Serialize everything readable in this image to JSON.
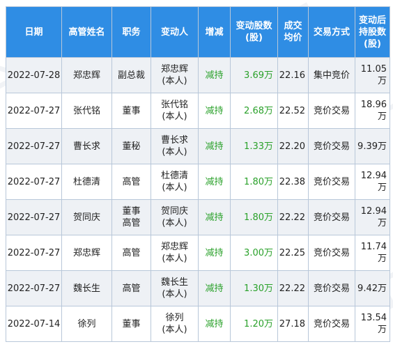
{
  "headers": {
    "date": "日期",
    "name": "高管姓名",
    "position": [
      "职务"
    ],
    "changer": "变动人",
    "direction": "增减",
    "change_shares": [
      "变动股数",
      "(股)"
    ],
    "avg_price": [
      "成交",
      "均价"
    ],
    "method": "交易方式",
    "holdings": [
      "变动后",
      "持股数",
      "(股)"
    ]
  },
  "rows": [
    {
      "date": "2022-07-28",
      "name": "郑忠辉",
      "position": [
        "副总裁"
      ],
      "changer": [
        "郑忠辉",
        "(本人)"
      ],
      "direction": "减持",
      "shares": "3.69万",
      "price": "22.16",
      "method": "集中竞价",
      "holdings": "11.05万"
    },
    {
      "date": "2022-07-27",
      "name": "张代铭",
      "position": [
        "董事"
      ],
      "changer": [
        "张代铭",
        "(本人)"
      ],
      "direction": "减持",
      "shares": "2.68万",
      "price": "22.52",
      "method": "竞价交易",
      "holdings": "18.96万"
    },
    {
      "date": "2022-07-27",
      "name": "曹长求",
      "position": [
        "董秘"
      ],
      "changer": [
        "曹长求",
        "(本人)"
      ],
      "direction": "减持",
      "shares": "1.33万",
      "price": "22.20",
      "method": "竞价交易",
      "holdings": "9.39万"
    },
    {
      "date": "2022-07-27",
      "name": "杜德清",
      "position": [
        "高管"
      ],
      "changer": [
        "杜德清",
        "(本人)"
      ],
      "direction": "减持",
      "shares": "1.80万",
      "price": "22.38",
      "method": "竞价交易",
      "holdings": "12.94万"
    },
    {
      "date": "2022-07-27",
      "name": "贺同庆",
      "position": [
        "董事",
        "高管"
      ],
      "changer": [
        "贺同庆",
        "(本人)"
      ],
      "direction": "减持",
      "shares": "1.80万",
      "price": "22.22",
      "method": "竞价交易",
      "holdings": "12.94万"
    },
    {
      "date": "2022-07-27",
      "name": "郑忠辉",
      "position": [
        "高管"
      ],
      "changer": [
        "郑忠辉",
        "(本人)"
      ],
      "direction": "减持",
      "shares": "3.00万",
      "price": "22.25",
      "method": "竞价交易",
      "holdings": "11.74万"
    },
    {
      "date": "2022-07-27",
      "name": "魏长生",
      "position": [
        "高管"
      ],
      "changer": [
        "魏长生",
        "(本人)"
      ],
      "direction": "减持",
      "shares": "1.30万",
      "price": "22.22",
      "method": "竞价交易",
      "holdings": "9.42万"
    },
    {
      "date": "2022-07-14",
      "name": "徐列",
      "position": [
        "董事"
      ],
      "changer": [
        "徐列",
        "(本人)"
      ],
      "direction": "减持",
      "shares": "1.20万",
      "price": "27.18",
      "method": "竞价交易",
      "holdings": "13.54万"
    }
  ],
  "watermark": [
    "证",
    "券",
    "之",
    "星"
  ],
  "colors": {
    "header_bg": "#2f8de4",
    "decrease": "#2aa12a",
    "row_alt": "#eef1f5"
  }
}
